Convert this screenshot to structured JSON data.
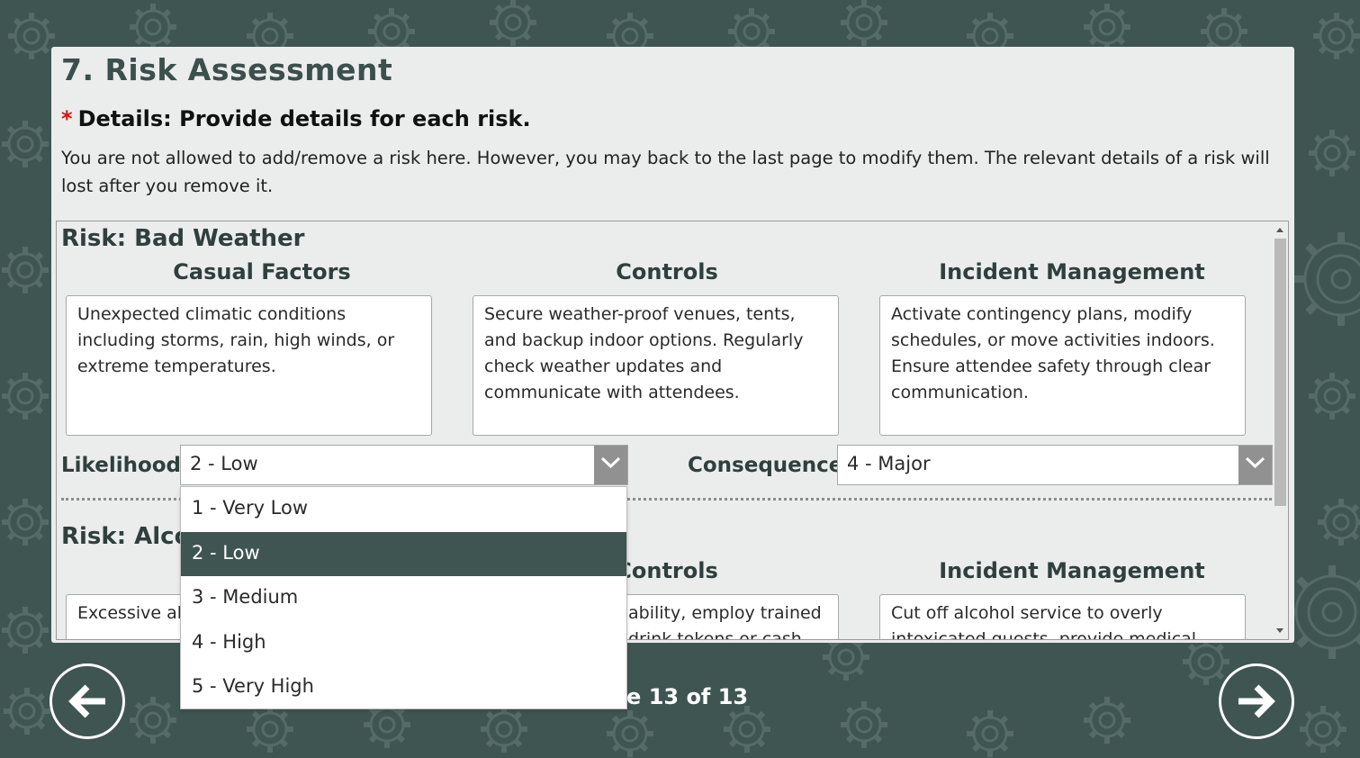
{
  "page": {
    "title": "7. Risk Assessment",
    "question_required_marker": "*",
    "question": "Details: Provide details for each risk.",
    "instructions": "You are not allowed to add/remove a risk here. However, you may back to the last page to modify them. The relevant details of a risk will lost after you remove it."
  },
  "columns": {
    "causal": "Casual Factors",
    "controls": "Controls",
    "incident": "Incident Management"
  },
  "labels": {
    "likelihood": "Likelihood",
    "consequence": "Consequence"
  },
  "risks": [
    {
      "title": "Risk: Bad Weather",
      "causal_factors": "Unexpected climatic conditions including storms, rain, high winds, or extreme temperatures.",
      "controls": "Secure weather-proof venues, tents, and backup indoor options. Regularly check weather updates and communicate with attendees.",
      "incident_management": "Activate contingency plans, modify schedules, or move activities indoors. Ensure attendee safety through clear communication.",
      "likelihood": "2 - Low",
      "consequence": "4 - Major"
    },
    {
      "title": "Risk: Alcol",
      "causal_factors": "Excessive alc monitoring c",
      "controls": "ability, employ trained drink tokens or cash bars",
      "incident_management": "Cut off alcohol service to overly intoxicated guests, provide medical assistance, and safe"
    }
  ],
  "likelihood_options": [
    "1 - Very Low",
    "2 - Low",
    "3 - Medium",
    "4 - High",
    "5 - Very High"
  ],
  "likelihood_selected_index": 1,
  "footer": {
    "page_indicator": "ge 13 of 13"
  },
  "icons": {
    "back": "arrow-left-icon",
    "next": "arrow-right-icon",
    "dropdown": "chevron-down-icon",
    "background": "gear-pattern"
  },
  "colors": {
    "background": "#3f5552",
    "panel": "#ebecec",
    "required": "#d11414",
    "selected_option": "#3f5552",
    "dropdown_button": "#919191"
  }
}
